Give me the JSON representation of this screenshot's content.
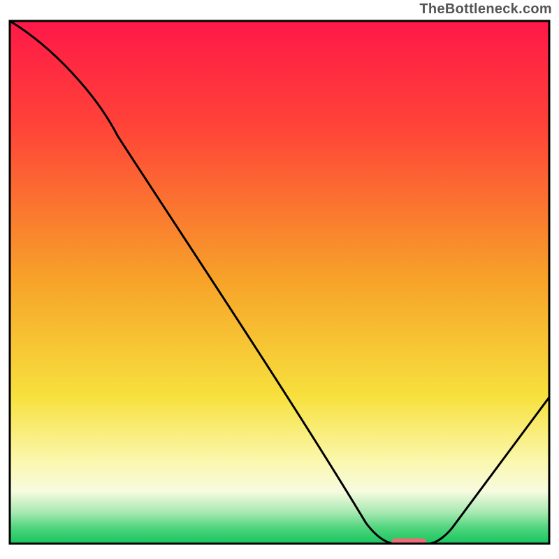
{
  "watermark": "TheBottleneck.com",
  "chart_data": {
    "type": "line",
    "title": "",
    "xlabel": "",
    "ylabel": "",
    "xlim": [
      0,
      1
    ],
    "ylim": [
      0,
      1
    ],
    "x": [
      0.0,
      0.2,
      0.68,
      0.74,
      0.78,
      1.0
    ],
    "values": [
      1.0,
      0.78,
      0.01,
      0.0,
      0.0,
      0.28
    ],
    "marker_x": 0.74,
    "marker_y": 0.0,
    "background": {
      "description": "vertical gradient red→orange→yellow→pale-yellow→green",
      "stops": [
        {
          "at": 0.0,
          "color": "#ff1848"
        },
        {
          "at": 0.5,
          "color": "#f7a429"
        },
        {
          "at": 0.78,
          "color": "#f8ed4c"
        },
        {
          "at": 0.88,
          "color": "#fcf9c6"
        },
        {
          "at": 0.97,
          "color": "#5dd884"
        },
        {
          "at": 1.0,
          "color": "#18c65e"
        }
      ]
    },
    "annotations": []
  }
}
